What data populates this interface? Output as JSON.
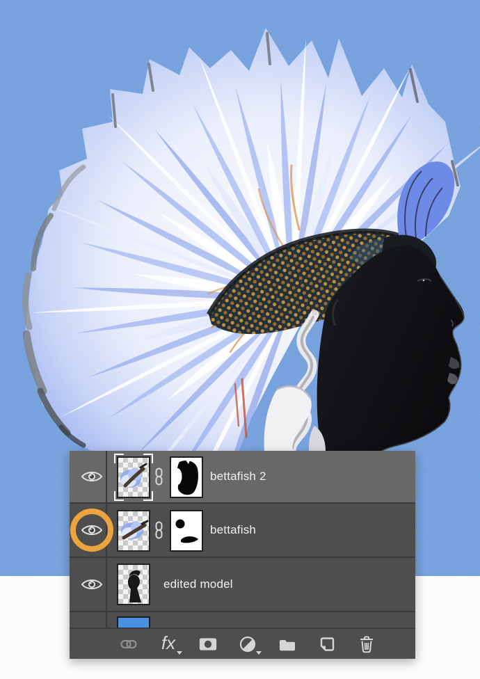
{
  "canvas": {
    "background_color": "#5c90d8",
    "bottom_band_color": "#fcfcfd",
    "subject": "model profile with betta-fish-fin mohawk"
  },
  "panel": {
    "background_color": "#4e4e4e",
    "selected_row_color": "#686868",
    "divider_color": "#3a3a3a",
    "highlight_ring_color": "#eba43e",
    "rows": [
      {
        "label": "bettafish 2",
        "visible": true,
        "selected": true,
        "has_mask": true,
        "linked": true,
        "eye_highlighted": false
      },
      {
        "label": "bettafish",
        "visible": true,
        "selected": false,
        "has_mask": true,
        "linked": true,
        "eye_highlighted": true
      },
      {
        "label": "edited model",
        "visible": true,
        "selected": false,
        "has_mask": false,
        "linked": false,
        "eye_highlighted": false
      }
    ],
    "partial_row": {
      "thumbnail_color": "#4a90e2"
    },
    "toolbar": {
      "fx_label": "fx",
      "icons": [
        "link-icon",
        "fx-icon",
        "layer-mask-icon",
        "adjustment-layer-icon",
        "folder-icon",
        "new-layer-icon",
        "trash-icon"
      ]
    }
  }
}
